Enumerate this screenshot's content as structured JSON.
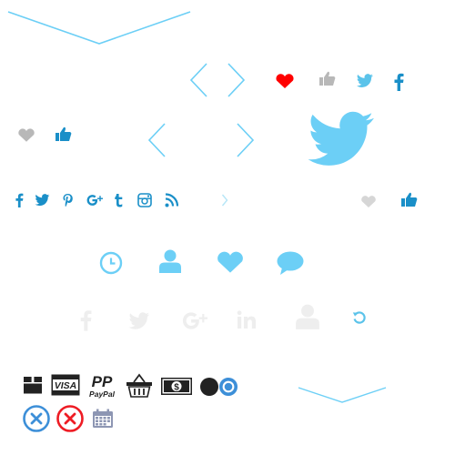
{
  "colors": {
    "light_blue": "#6ccff6",
    "mid_blue": "#5bc3ea",
    "dark_blue": "#1a8fc8",
    "red": "#ff0000",
    "gray": "#b8b8b8",
    "light_gray": "#d6d6d6",
    "faint_gray": "#eeeeee",
    "black": "#222222",
    "cancel_blue": "#3d8fd8",
    "cancel_red": "#ee1c24",
    "calendar_gray": "#8d96b3"
  },
  "sprites": [
    {
      "name": "large-chevron-down-icon",
      "interactable": true
    },
    {
      "name": "chevron-left-icon",
      "interactable": true
    },
    {
      "name": "chevron-right-icon",
      "interactable": true
    },
    {
      "name": "heart-active-icon",
      "interactable": true
    },
    {
      "name": "thumbs-up-icon",
      "interactable": true
    },
    {
      "name": "twitter-icon",
      "interactable": true
    },
    {
      "name": "facebook-icon",
      "interactable": true
    },
    {
      "name": "heart-icon",
      "interactable": true
    },
    {
      "name": "thumbs-up-active-icon",
      "interactable": true
    },
    {
      "name": "chevron-left-icon",
      "interactable": true
    },
    {
      "name": "chevron-right-icon",
      "interactable": true
    },
    {
      "name": "twitter-large-icon",
      "interactable": false
    },
    {
      "name": "facebook-icon",
      "interactable": true
    },
    {
      "name": "twitter-icon",
      "interactable": true
    },
    {
      "name": "pinterest-icon",
      "interactable": true
    },
    {
      "name": "google-plus-icon",
      "interactable": true
    },
    {
      "name": "tumblr-icon",
      "interactable": true
    },
    {
      "name": "instagram-icon",
      "interactable": true
    },
    {
      "name": "rss-icon",
      "interactable": true
    },
    {
      "name": "chevron-right-small-icon",
      "interactable": true
    },
    {
      "name": "heart-icon",
      "interactable": true
    },
    {
      "name": "thumbs-up-active-icon",
      "interactable": true
    },
    {
      "name": "clock-icon",
      "interactable": false
    },
    {
      "name": "user-icon",
      "interactable": false
    },
    {
      "name": "heart-icon",
      "interactable": false
    },
    {
      "name": "comment-icon",
      "interactable": false
    },
    {
      "name": "facebook-faint-icon",
      "interactable": true
    },
    {
      "name": "twitter-faint-icon",
      "interactable": true
    },
    {
      "name": "google-plus-faint-icon",
      "interactable": true
    },
    {
      "name": "linkedin-faint-icon",
      "interactable": true
    },
    {
      "name": "user-faint-icon",
      "interactable": false
    },
    {
      "name": "refresh-icon",
      "interactable": true
    },
    {
      "name": "package-icon",
      "interactable": false
    },
    {
      "name": "visa-icon",
      "interactable": false
    },
    {
      "name": "paypal-icon",
      "interactable": false
    },
    {
      "name": "shopping-basket-icon",
      "interactable": false
    },
    {
      "name": "cash-icon",
      "interactable": false
    },
    {
      "name": "radio-unchecked-icon",
      "interactable": true
    },
    {
      "name": "radio-checked-icon",
      "interactable": true
    },
    {
      "name": "chevron-down-icon",
      "interactable": true
    },
    {
      "name": "cancel-blue-icon",
      "interactable": true
    },
    {
      "name": "cancel-red-icon",
      "interactable": true
    },
    {
      "name": "calendar-icon",
      "interactable": true
    }
  ],
  "labels": {
    "visa": "VISA",
    "paypal_mark": "PP",
    "paypal_word": "PayPal",
    "cash": "$"
  }
}
